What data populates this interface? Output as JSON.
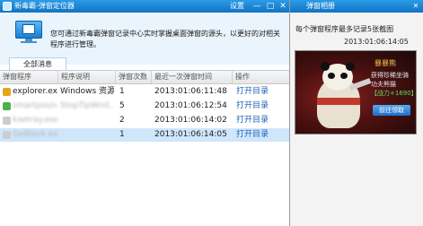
{
  "main_window": {
    "title": "新毒霸-弹窗定位器",
    "settings_label": "设置",
    "minimize_label": "—",
    "maximize_label": "□",
    "close_label": "✕"
  },
  "info": {
    "text": "您可通过新毒霸弹窗记录中心实时掌握桌面弹窗的源头，以更好的对相关程序进行管理。"
  },
  "tabs": [
    {
      "label": "全部消息"
    }
  ],
  "table": {
    "headers": [
      "弹窗程序",
      "程序说明",
      "弹窗次数",
      "最近一次弹窗时间",
      "操作"
    ],
    "rows": [
      {
        "program": "explorer.exe",
        "description": "Windows 资源...",
        "count": "1",
        "time": "2013:01:06:11:48",
        "action": "打开目录",
        "icon_color": "#e3a41f",
        "blurred": false,
        "selected": false
      },
      {
        "program": "smartpound.exe",
        "description": "StopTipWnd...",
        "count": "5",
        "time": "2013:01:06:12:54",
        "action": "打开目录",
        "icon_color": "#4caf50",
        "blurred": true,
        "selected": false
      },
      {
        "program": "kxetray.exe",
        "description": "",
        "count": "2",
        "time": "2013:01:06:14:02",
        "action": "打开目录",
        "icon_color": "#cccccc",
        "blurred": true,
        "selected": false
      },
      {
        "program": "GeBlock.exe",
        "description": "",
        "count": "1",
        "time": "2013:01:06:14:05",
        "action": "打开目录",
        "icon_color": "#cccccc",
        "blurred": true,
        "selected": true
      }
    ]
  },
  "right_panel": {
    "title": "弹窗相册",
    "close_label": "✕",
    "description": "每个弹窗程序最多记录5张截图",
    "timestamp": "2013:01:06:14:05",
    "popup": {
      "title": "暴暴熊",
      "line1": "获得珍稀坐骑",
      "line2": "功夫熊猫",
      "line3": "【战力+1690】",
      "button": "前往领取"
    }
  }
}
